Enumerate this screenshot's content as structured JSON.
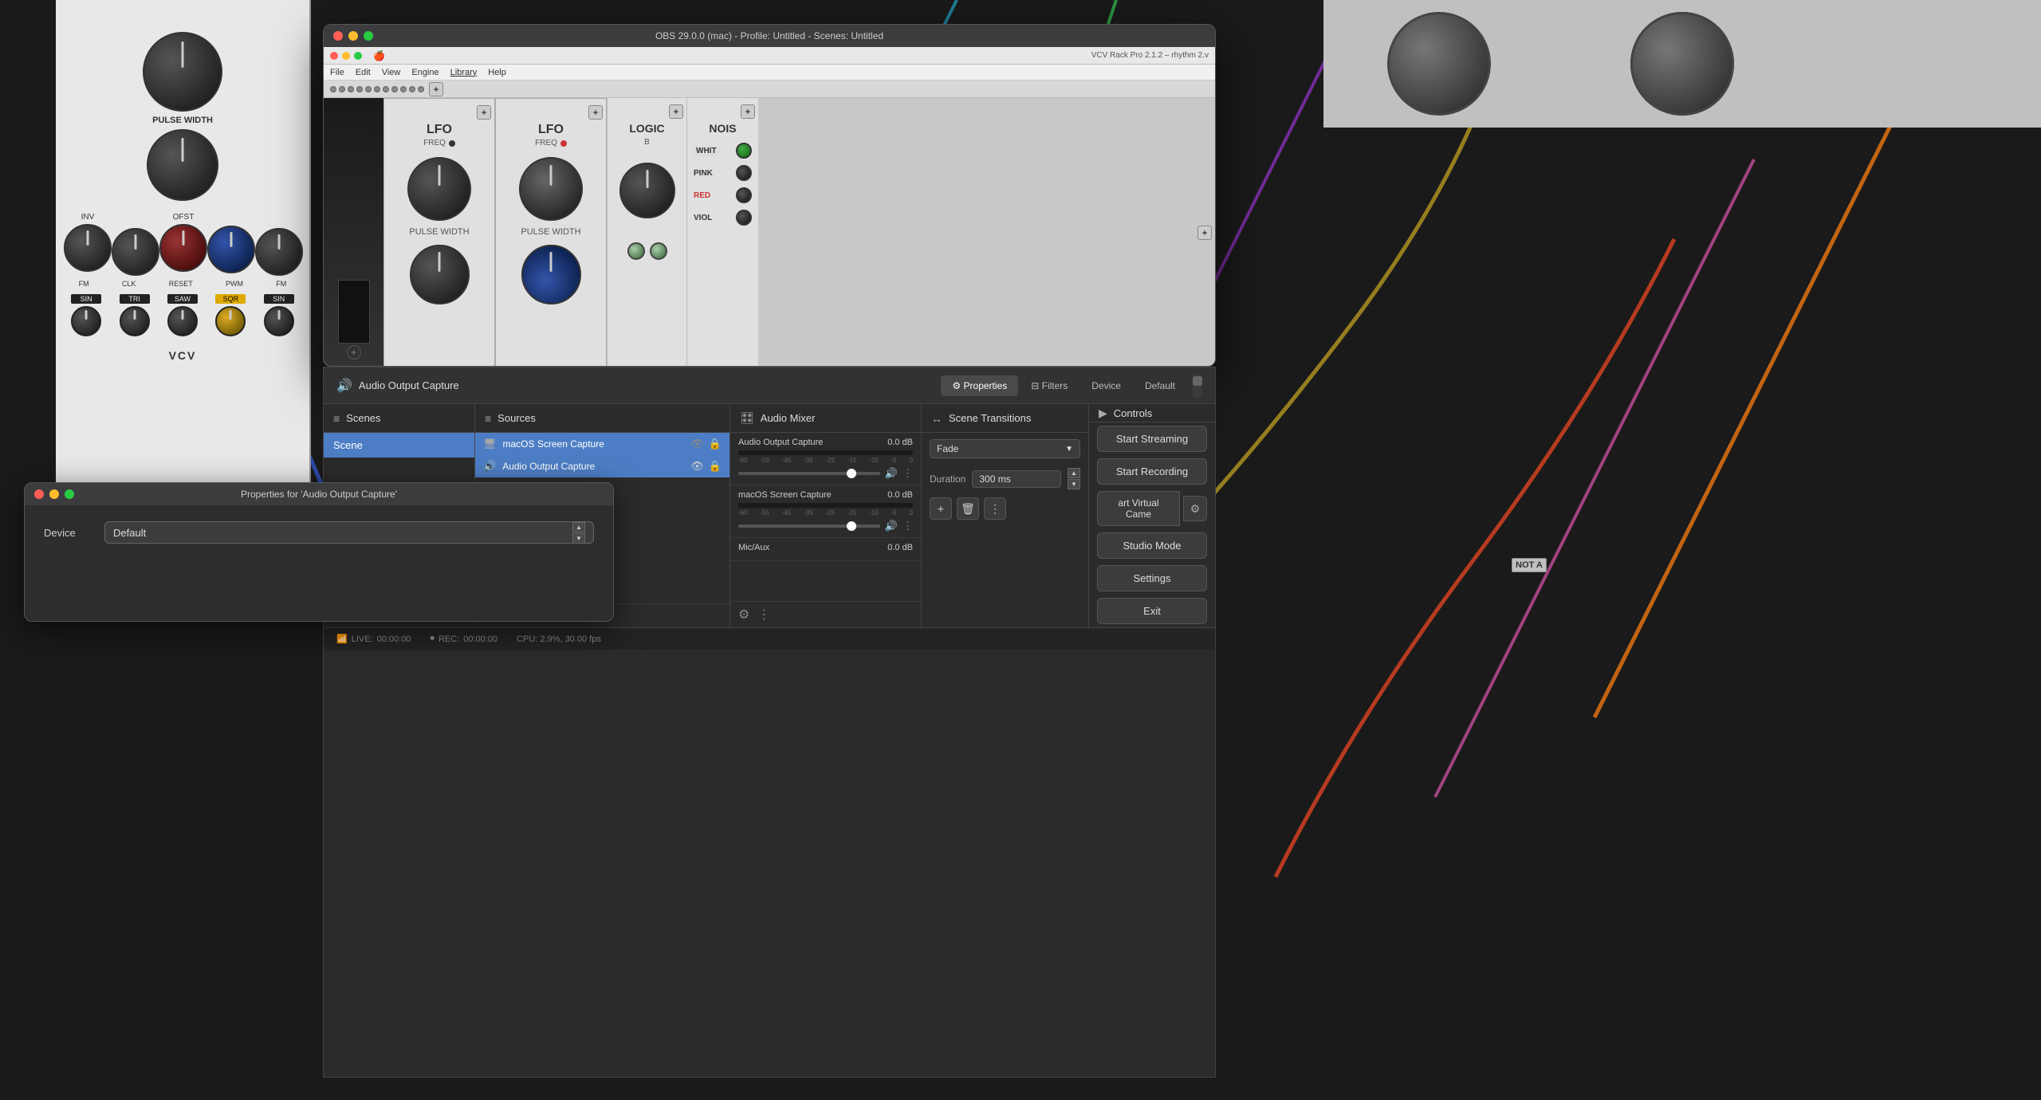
{
  "background": {
    "module_left": {
      "title": "VCV",
      "pulse_width_label": "PULSE WIDTH",
      "inv_label": "INV",
      "ofst_label": "OFST",
      "fm_label1": "FM",
      "clk_label": "CLK",
      "reset_label": "RESET",
      "pwm_label": "PWM",
      "fm_label2": "FM",
      "sin_label1": "SIN",
      "tri_label": "TRI",
      "saw_label": "SAW",
      "sqr_label": "SQR",
      "sin_label2": "SIN"
    }
  },
  "obs_inner_window": {
    "titlebar": "VCV Rack Pro 2.1.2 – rhythm 2.v",
    "menu_items": [
      "File",
      "Edit",
      "View",
      "Engine",
      "Library",
      "Help"
    ],
    "lfo1": {
      "title": "LFO",
      "freq_label": "FREQ",
      "pulse_width_label": "PULSE WIDTH"
    },
    "lfo2": {
      "title": "LFO",
      "freq_label": "FREQ",
      "pulse_width_label": "PULSE WIDTH"
    },
    "logic_label": "LOGIC",
    "nois_label": "NOIS",
    "not_a_label": "NOT A",
    "whit_label": "WHIT",
    "pink_label": "PINK",
    "red_label": "RED",
    "viol_label": "VIOL"
  },
  "obs_window": {
    "title": "OBS 29.0.0 (mac) - Profile: Untitled - Scenes: Untitled",
    "traffic_lights": [
      "close",
      "minimize",
      "maximize"
    ]
  },
  "properties_bar": {
    "source_icon": "🔊",
    "source_name": "Audio Output Capture",
    "tabs": [
      {
        "label": "Properties",
        "active": true,
        "icon": "⚙"
      },
      {
        "label": "Filters",
        "active": false,
        "icon": "⊟"
      },
      {
        "label": "Device",
        "active": false
      },
      {
        "label": "Default",
        "active": false
      }
    ],
    "scroll_indicator": true
  },
  "panels": {
    "scenes": {
      "header_icon": "≡",
      "header_label": "Scenes",
      "items": [
        {
          "name": "Scene",
          "active": true
        }
      ]
    },
    "sources": {
      "header_icon": "≡",
      "header_label": "Sources",
      "items": [
        {
          "icon": "🖥",
          "name": "macOS Screen Capture",
          "visible": true,
          "locked": true
        },
        {
          "icon": "🔊",
          "name": "Audio Output Capture",
          "visible": true,
          "locked": true,
          "active": true
        }
      ]
    },
    "audio_mixer": {
      "header_icon": "🎛",
      "header_label": "Audio Mixer",
      "tracks": [
        {
          "name": "Audio Output Capture",
          "db": "0.0 dB",
          "meter_labels": [
            "-60",
            "-55",
            "-45",
            "-35",
            "-25",
            "-15",
            "-10",
            "-5",
            "0"
          ]
        },
        {
          "name": "macOS Screen Capture",
          "db": "0.0 dB",
          "meter_labels": [
            "-60",
            "-55",
            "-45",
            "-35",
            "-25",
            "-15",
            "-10",
            "-5",
            "0"
          ]
        },
        {
          "name": "Mic/Aux",
          "db": "0.0 dB"
        }
      ],
      "bottom_icons": [
        "⚙",
        "⋮"
      ]
    },
    "scene_transitions": {
      "header_icon": "↔",
      "header_label": "Scene Transitions",
      "transition_name": "Fade",
      "duration_label": "Duration",
      "duration_value": "300 ms",
      "buttons": [
        "+",
        "🗑",
        "⋮"
      ]
    },
    "controls": {
      "header_label": "Controls",
      "header_icon": "▶",
      "buttons": [
        {
          "label": "Start Streaming",
          "key": "start_streaming"
        },
        {
          "label": "Start Recording",
          "key": "start_recording"
        }
      ],
      "virtual_cam": "art Virtual Came",
      "studio_mode": "Studio Mode",
      "settings": "Settings",
      "exit": "Exit"
    }
  },
  "status_bar": {
    "live_label": "LIVE:",
    "live_time": "00:00:00",
    "rec_label": "REC:",
    "rec_time": "00:00:00",
    "cpu_label": "CPU: 2.9%, 30.00 fps"
  },
  "properties_dialog": {
    "title": "Properties for 'Audio Output Capture'",
    "device_label": "Device",
    "device_value": "Default",
    "traffic_lights": [
      "close",
      "minimize",
      "maximize"
    ]
  }
}
